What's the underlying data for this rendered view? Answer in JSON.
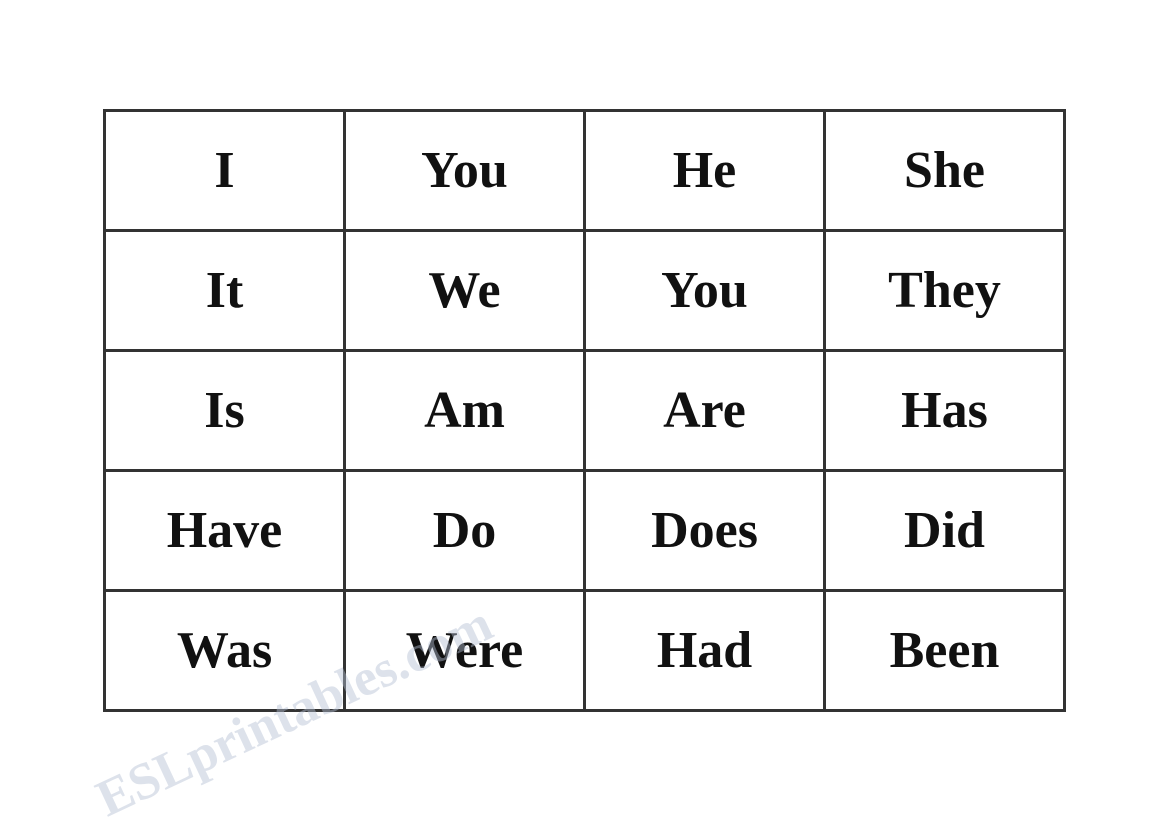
{
  "table": {
    "rows": [
      [
        "I",
        "You",
        "He",
        "She"
      ],
      [
        "It",
        "We",
        "You",
        "They"
      ],
      [
        "Is",
        "Am",
        "Are",
        "Has"
      ],
      [
        "Have",
        "Do",
        "Does",
        "Did"
      ],
      [
        "Was",
        "Were",
        "Had",
        "Been"
      ]
    ]
  },
  "watermark": {
    "text": "ESLprintables.com"
  }
}
